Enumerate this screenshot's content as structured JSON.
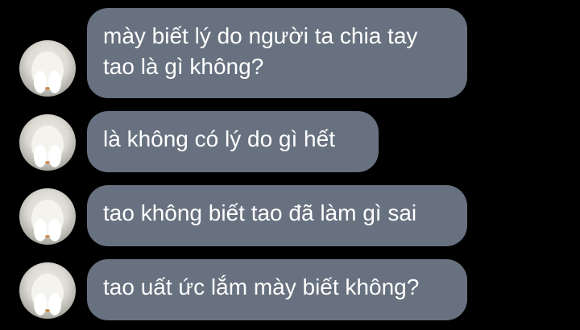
{
  "conversation": {
    "messages": [
      {
        "text": "mày biết lý do người ta chia tay\ntao là gì không?"
      },
      {
        "text": "là không có lý do gì hết"
      },
      {
        "text": "tao không biết tao đã làm gì sai"
      },
      {
        "text": "tao uất ức lắm mày biết không?"
      }
    ],
    "avatar_icon": "white-bunny-avatar",
    "colors": {
      "background": "#000000",
      "bubble": "#67717f",
      "text": "#ffffff"
    }
  }
}
